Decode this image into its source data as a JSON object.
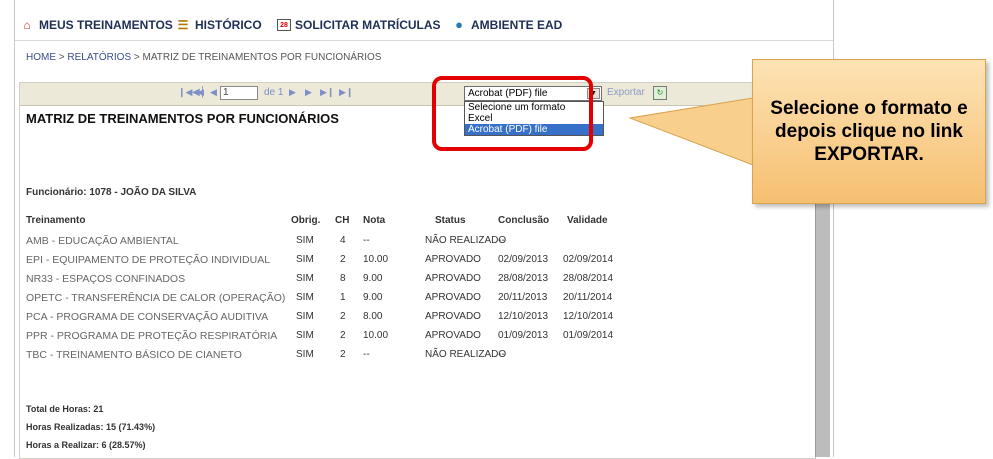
{
  "nav": {
    "items": [
      {
        "label": "MEUS TREINAMENTOS",
        "icon": "home-icon"
      },
      {
        "label": "HISTÓRICO",
        "icon": "history-icon"
      },
      {
        "label": "SOLICITAR MATRÍCULAS",
        "icon": "calendar-icon"
      },
      {
        "label": "AMBIENTE EAD",
        "icon": "globe-icon"
      }
    ]
  },
  "breadcrumb": {
    "home": "HOME",
    "relatorios": "RELATÓRIOS",
    "current": "MATRIZ DE TREINAMENTOS POR FUNCIONÁRIOS",
    "sep": ">"
  },
  "toolbar": {
    "page_value": "1",
    "page_of": "de 1",
    "format_selected": "Acrobat (PDF) file",
    "export_label": "Exportar",
    "format_options": [
      "Selecione um formato",
      "Excel",
      "Acrobat (PDF) file"
    ]
  },
  "report": {
    "title": "MATRIZ DE TREINAMENTOS POR FUNCIONÁRIOS",
    "employee": "Funcionário: 1078 - JOÃO DA SILVA",
    "columns": [
      "Treinamento",
      "Obrig.",
      "CH",
      "Nota",
      "Status",
      "Conclusão",
      "Validade"
    ],
    "rows": [
      {
        "name": "AMB - EDUCAÇÃO AMBIENTAL",
        "obrig": "SIM",
        "ch": "4",
        "nota": "--",
        "status": "NÃO REALIZADO",
        "conclusao": "--",
        "validade": ""
      },
      {
        "name": "EPI - EQUIPAMENTO DE PROTEÇÃO INDIVIDUAL",
        "obrig": "SIM",
        "ch": "2",
        "nota": "10.00",
        "status": "APROVADO",
        "conclusao": "02/09/2013",
        "validade": "02/09/2014"
      },
      {
        "name": "NR33 - ESPAÇOS CONFINADOS",
        "obrig": "SIM",
        "ch": "8",
        "nota": "9.00",
        "status": "APROVADO",
        "conclusao": "28/08/2013",
        "validade": "28/08/2014"
      },
      {
        "name": "OPETC - TRANSFERÊNCIA DE CALOR (OPERAÇÃO)",
        "obrig": "SIM",
        "ch": "1",
        "nota": "9.00",
        "status": "APROVADO",
        "conclusao": "20/11/2013",
        "validade": "20/11/2014"
      },
      {
        "name": "PCA - PROGRAMA DE CONSERVAÇÃO AUDITIVA",
        "obrig": "SIM",
        "ch": "2",
        "nota": "8.00",
        "status": "APROVADO",
        "conclusao": "12/10/2013",
        "validade": "12/10/2014"
      },
      {
        "name": "PPR - PROGRAMA DE PROTEÇÃO RESPIRATÓRIA",
        "obrig": "SIM",
        "ch": "2",
        "nota": "10.00",
        "status": "APROVADO",
        "conclusao": "01/09/2013",
        "validade": "01/09/2014"
      },
      {
        "name": "TBC - TREINAMENTO BÁSICO DE CIANETO",
        "obrig": "SIM",
        "ch": "2",
        "nota": "--",
        "status": "NÃO REALIZADO",
        "conclusao": "--",
        "validade": ""
      }
    ],
    "totals": {
      "total_horas": "Total de Horas:   21",
      "horas_realizadas": "Horas Realizadas:  15 (71.43%)",
      "horas_a_realizar": "Horas a Realizar:   6 (28.57%)"
    }
  },
  "callout": {
    "text": "Selecione o formato e depois clique no link EXPORTAR."
  },
  "colors": {
    "highlight": "#e30000",
    "callout_top": "#fde3b4",
    "callout_bottom": "#f6bf72",
    "selected_option": "#3670c9",
    "nav_text": "#1f2f55"
  }
}
